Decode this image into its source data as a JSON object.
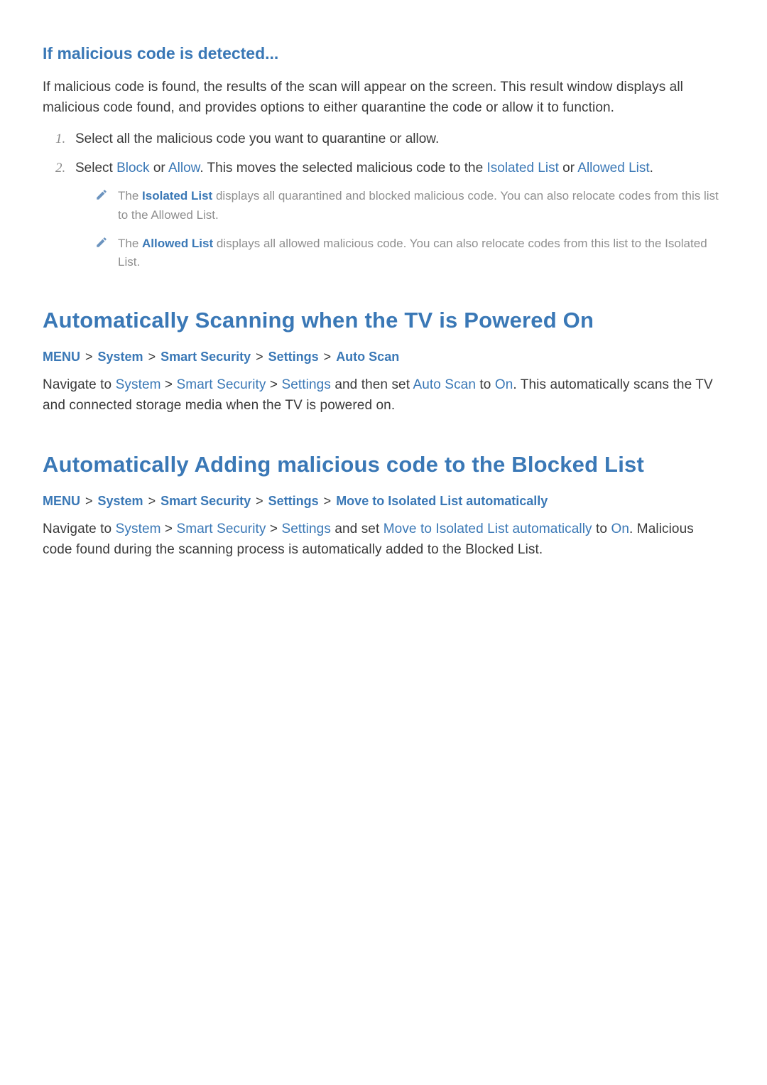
{
  "section1": {
    "heading": "If malicious code is detected...",
    "intro": "If malicious code is found, the results of the scan will appear on the screen. This result window displays all malicious code found, and provides options to either quarantine the code or allow it to function.",
    "step1_num": "1.",
    "step1": "Select all the malicious code you want to quarantine or allow.",
    "step2_num": "2.",
    "step2_a": "Select ",
    "step2_block": "Block",
    "step2_or": " or ",
    "step2_allow": "Allow",
    "step2_b": ". This moves the selected malicious code to the ",
    "step2_iso": "Isolated List",
    "step2_or2": " or ",
    "step2_alw": "Allowed List",
    "step2_end": ".",
    "note1_a": "The ",
    "note1_iso": "Isolated List",
    "note1_b": " displays all quarantined and blocked malicious code. You can also relocate codes from this list to the Allowed List.",
    "note2_a": "The ",
    "note2_alw": "Allowed List",
    "note2_b": " displays all allowed malicious code. You can also relocate codes from this list to the Isolated List."
  },
  "section2": {
    "heading": "Automatically Scanning when the TV is Powered On",
    "bc": [
      "MENU",
      "System",
      "Smart Security",
      "Settings",
      "Auto Scan"
    ],
    "p_a": "Navigate to ",
    "p_sys": "System",
    "p_ch1": " > ",
    "p_ss": "Smart Security",
    "p_ch2": " > ",
    "p_set": "Settings",
    "p_b": " and then set ",
    "p_as": "Auto Scan",
    "p_c": " to ",
    "p_on": "On",
    "p_d": ". This automatically scans the TV and connected storage media when the TV is powered on."
  },
  "section3": {
    "heading": "Automatically Adding malicious code to the Blocked List",
    "bc": [
      "MENU",
      "System",
      "Smart Security",
      "Settings",
      "Move to Isolated List automatically"
    ],
    "p_a": "Navigate to ",
    "p_sys": "System",
    "p_ch1": " > ",
    "p_ss": "Smart Security",
    "p_ch2": " > ",
    "p_set": "Settings",
    "p_b": " and set ",
    "p_mil": "Move to Isolated List automatically",
    "p_c": " to ",
    "p_on": "On",
    "p_d": ". Malicious code found during the scanning process is automatically added to the Blocked List."
  }
}
